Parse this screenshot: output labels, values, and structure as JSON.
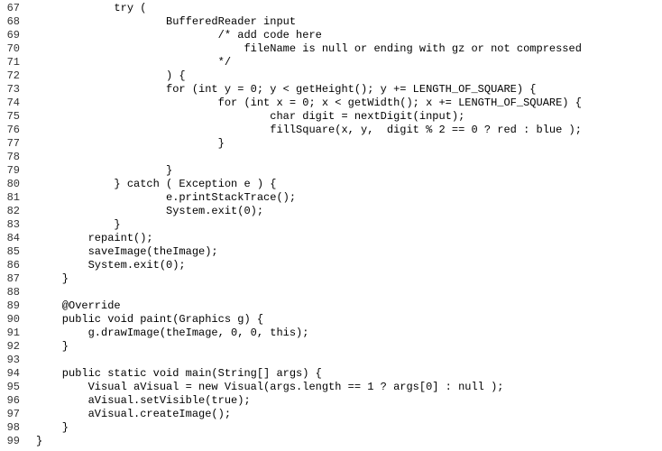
{
  "lines": [
    {
      "num": "67",
      "code": "            try ("
    },
    {
      "num": "68",
      "code": "                    BufferedReader input"
    },
    {
      "num": "69",
      "code": "                            /* add code here"
    },
    {
      "num": "70",
      "code": "                                fileName is null or ending with gz or not compressed"
    },
    {
      "num": "71",
      "code": "                            */"
    },
    {
      "num": "72",
      "code": "                    ) {"
    },
    {
      "num": "73",
      "code": "                    for (int y = 0; y < getHeight(); y += LENGTH_OF_SQUARE) {"
    },
    {
      "num": "74",
      "code": "                            for (int x = 0; x < getWidth(); x += LENGTH_OF_SQUARE) {"
    },
    {
      "num": "75",
      "code": "                                    char digit = nextDigit(input);"
    },
    {
      "num": "76",
      "code": "                                    fillSquare(x, y,  digit % 2 == 0 ? red : blue );"
    },
    {
      "num": "77",
      "code": "                            }"
    },
    {
      "num": "78",
      "code": ""
    },
    {
      "num": "79",
      "code": "                    }"
    },
    {
      "num": "80",
      "code": "            } catch ( Exception e ) {"
    },
    {
      "num": "81",
      "code": "                    e.printStackTrace();"
    },
    {
      "num": "82",
      "code": "                    System.exit(0);"
    },
    {
      "num": "83",
      "code": "            }"
    },
    {
      "num": "84",
      "code": "        repaint();"
    },
    {
      "num": "85",
      "code": "        saveImage(theImage);"
    },
    {
      "num": "86",
      "code": "        System.exit(0);"
    },
    {
      "num": "87",
      "code": "    }"
    },
    {
      "num": "88",
      "code": ""
    },
    {
      "num": "89",
      "code": "    @Override"
    },
    {
      "num": "90",
      "code": "    public void paint(Graphics g) {"
    },
    {
      "num": "91",
      "code": "        g.drawImage(theImage, 0, 0, this);"
    },
    {
      "num": "92",
      "code": "    }"
    },
    {
      "num": "93",
      "code": ""
    },
    {
      "num": "94",
      "code": "    public static void main(String[] args) {"
    },
    {
      "num": "95",
      "code": "        Visual aVisual = new Visual(args.length == 1 ? args[0] : null );"
    },
    {
      "num": "96",
      "code": "        aVisual.setVisible(true);"
    },
    {
      "num": "97",
      "code": "        aVisual.createImage();"
    },
    {
      "num": "98",
      "code": "    }"
    },
    {
      "num": "99",
      "code": "}"
    }
  ]
}
